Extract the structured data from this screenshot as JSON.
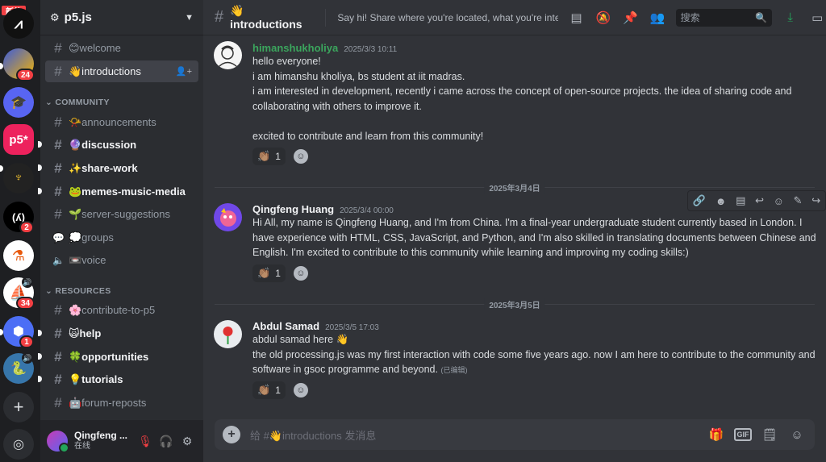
{
  "servers": {
    "new_label": "新的",
    "badges": [
      "24",
      "2",
      "34",
      "1"
    ],
    "p5_label": "p5*"
  },
  "sidebar": {
    "server_name": "p5.js",
    "channels_top": [
      {
        "label": "😊welcome"
      },
      {
        "label": "👋introductions"
      }
    ],
    "category_community": "COMMUNITY",
    "community": [
      {
        "label": "📯announcements"
      },
      {
        "label": "🔮discussion"
      },
      {
        "label": "✨share-work"
      },
      {
        "label": "🐸memes-music-media"
      },
      {
        "label": "🌱server-suggestions"
      },
      {
        "label": "💭groups"
      },
      {
        "label": "📼voice"
      }
    ],
    "category_resources": "RESOURCES",
    "resources": [
      {
        "label": "🌸contribute-to-p5"
      },
      {
        "label": "🙀help"
      },
      {
        "label": "🍀opportunities"
      },
      {
        "label": "💡tutorials"
      },
      {
        "label": "🤖forum-reposts"
      }
    ]
  },
  "user": {
    "name": "Qingfeng ...",
    "status": "在线"
  },
  "header": {
    "channel": "👋introductions",
    "topic": "Say hi! Share where you're located, what you're intere...",
    "search_placeholder": "搜索"
  },
  "messages": [
    {
      "author": "himanshukholiya",
      "author_color": "#3ba55d",
      "timestamp": "2025/3/3 10:11",
      "lines": [
        "hello everyone!",
        "i am himanshu kholiya, bs student at iit madras.",
        "i am interested in development, recently i came across the concept of open-source projects. the idea of sharing code and collaborating with others to improve it.",
        "",
        "excited to contribute and learn from this community!"
      ],
      "reaction_emoji": "👏🏽",
      "reaction_count": "1"
    },
    {
      "author": "Qingfeng Huang",
      "author_color": "#f2f3f5",
      "timestamp": "2025/3/4 00:00",
      "lines": [
        "Hi All, my name is Qingfeng Huang, and I'm from China. I'm a final-year undergraduate student currently based in London. I have experience with HTML, CSS, JavaScript, and Python, and I'm also skilled in translating documents between Chinese and English. I'm excited to contribute to this community while learning and improving my coding skills:)"
      ],
      "reaction_emoji": "👏🏽",
      "reaction_count": "1"
    },
    {
      "author": "Abdul Samad",
      "author_color": "#f2f3f5",
      "timestamp": "2025/3/5 17:03",
      "lines": [
        "abdul samad here 👋",
        "the old processing.js was my first interaction with code some five years ago. now I am here to contribute to the community and software in gsoc programme and beyond."
      ],
      "edited": "(已编辑)",
      "reaction_emoji": "👏🏽",
      "reaction_count": "1"
    }
  ],
  "date_dividers": [
    "2025年3月4日",
    "2025年3月5日"
  ],
  "composer": {
    "placeholder": "给 #👋introductions 发消息",
    "gif_label": "GIF"
  }
}
